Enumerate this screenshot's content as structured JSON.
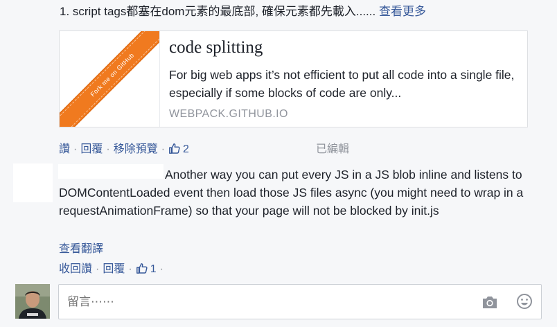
{
  "post": {
    "text_start": "1. script tags都塞在dom元素的最底部, 確保元素都先載入......",
    "see_more": "查看更多"
  },
  "link_card": {
    "ribbon_text": "Fork me on GitHub",
    "title": "code splitting",
    "description": "For big web apps it’s not efficient to put all code into a single file, especially if some blocks of code are only...",
    "domain": "WEBPACK.GITHUB.IO",
    "ribbon_color": "#f07a1f"
  },
  "post_actions": {
    "like": "讚",
    "reply": "回覆",
    "remove_preview": "移除預覽",
    "like_count": "2",
    "edited": "已編輯"
  },
  "comment": {
    "text": "Another way you can put every JS in a JS blob inline and listens to DOMContentLoaded event then load those JS files async (you might need to wrap in a requestAnimationFrame) so that your page will not be blocked by init.js",
    "see_translation": "查看翻譯",
    "unlike": "收回讚",
    "reply": "回覆",
    "like_count": "1"
  },
  "composer": {
    "placeholder": "留言⋯⋯",
    "icons": [
      "camera-icon",
      "smiley-icon"
    ]
  },
  "colors": {
    "link": "#365899",
    "meta": "#90949c",
    "text": "#1d2129",
    "background": "#f6f7f9"
  }
}
